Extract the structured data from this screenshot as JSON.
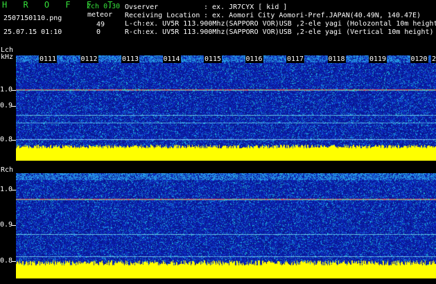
{
  "app": {
    "title": "H R O F F T",
    "version": "2ch 0.30",
    "mode": "meteor",
    "filename": "2507150110.png",
    "datetime": "25.07.15 01:10",
    "count_l": "49",
    "count_r": "0"
  },
  "info": {
    "observer_label": "Ovserver",
    "observer_value": ": ex. JR7CYX [ kid ]",
    "location_label": "Receiving Location",
    "location_value": ": ex. Aomori City Aomori-Pref.JAPAN(40.49N, 140.47E)",
    "lch_desc": "L-ch:ex. UV5R 113.900Mhz(SAPPORO VOR)USB ,2-ele yagi (Holozontal 10m height)",
    "rch_desc": "R-ch:ex. UV5R 113.900Mhz(SAPPORO VOR)USB ,2-ele yagi (Vertical 10m height)"
  },
  "lch": {
    "label": "Lch",
    "unit": "kHz",
    "ticks": [
      "1.0",
      "0.9",
      "0.8"
    ]
  },
  "rch": {
    "label": "Rch",
    "ticks": [
      "1.0",
      "0.9",
      "0.8"
    ]
  },
  "timestamps": [
    "0111",
    "0112",
    "0113",
    "0114",
    "0115",
    "0116",
    "0117",
    "0118",
    "0119",
    "0120"
  ],
  "trailing_timestamp": "2",
  "colors": {
    "noise_base": "#0a1a9a",
    "bar": "#ffff00",
    "text_green": "#35e03a"
  }
}
